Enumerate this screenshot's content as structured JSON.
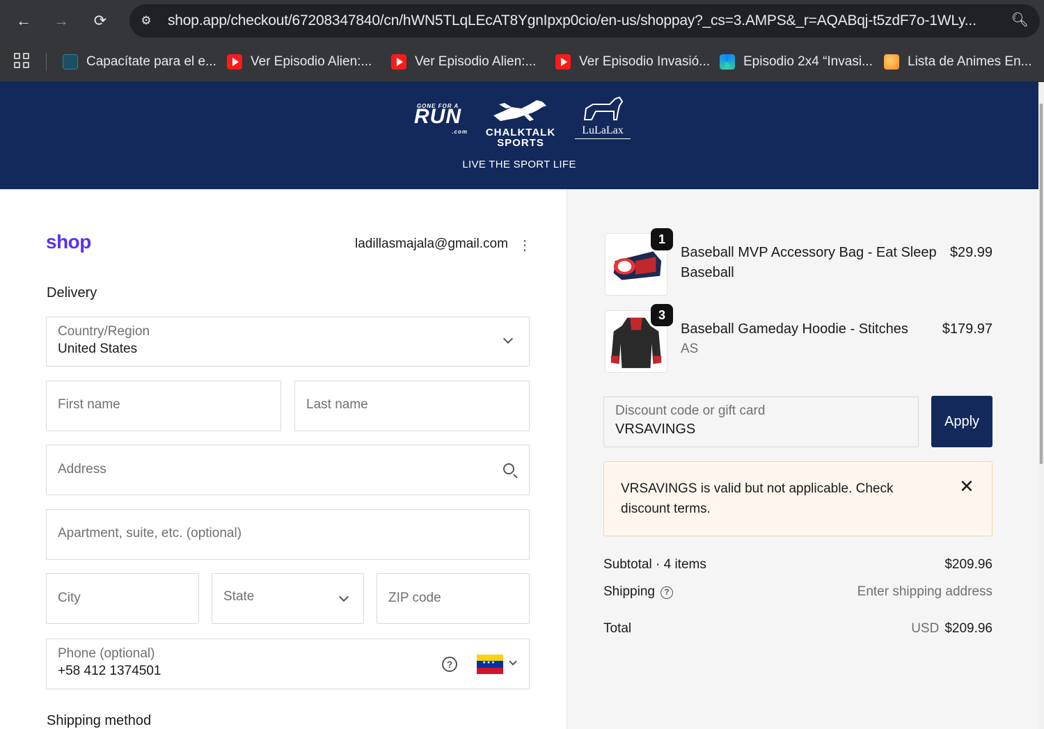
{
  "browser": {
    "url": "shop.app/checkout/67208347840/cn/hWN5TLqLEcAT8YgnIpxp0cio/en-us/shoppay?_cs=3.AMPS&_r=AQABqj-t5zdF7o-1WLy...",
    "bookmarks": [
      {
        "label": "Capacítate para el e...",
        "icon": "doc-icon"
      },
      {
        "label": "Ver Episodio Alien:...",
        "icon": "youtube-icon"
      },
      {
        "label": "Ver Episodio Alien:...",
        "icon": "youtube-icon"
      },
      {
        "label": "Ver Episodio Invasió...",
        "icon": "youtube-icon"
      },
      {
        "label": "Episodio 2x4 “Invasi...",
        "icon": "edge-icon"
      },
      {
        "label": "Lista de Animes En...",
        "icon": "anime-icon"
      }
    ]
  },
  "banner": {
    "logos": {
      "run_small": "GONE FOR A",
      "run_main": "RUN",
      "run_suffix": ".com",
      "chalk_line1": "CHALKTALK",
      "chalk_line2": "SPORTS",
      "lula": "LuLaLax"
    },
    "tagline": "LIVE THE SPORT LIFE"
  },
  "checkout": {
    "logo": "shop",
    "email": "ladillasmajala@gmail.com",
    "delivery_title": "Delivery",
    "country_label": "Country/Region",
    "country_value": "United States",
    "first_name_placeholder": "First name",
    "last_name_placeholder": "Last name",
    "address_placeholder": "Address",
    "apartment_placeholder": "Apartment, suite, etc. (optional)",
    "city_placeholder": "City",
    "state_placeholder": "State",
    "zip_placeholder": "ZIP code",
    "phone_label": "Phone (optional)",
    "phone_value": "+58 412 1374501",
    "shipping_method_title": "Shipping method"
  },
  "summary": {
    "items": [
      {
        "qty": "1",
        "name": "Baseball MVP Accessory Bag - Eat Sleep Baseball",
        "variant": "",
        "price": "$29.99"
      },
      {
        "qty": "3",
        "name": "Baseball Gameday Hoodie - Stitches",
        "variant": "AS",
        "price": "$179.97"
      }
    ],
    "discount_label": "Discount code or gift card",
    "discount_value": "VRSAVINGS",
    "apply_label": "Apply",
    "alert_message": "VRSAVINGS is valid but not applicable. Check discount terms.",
    "subtotal_label": "Subtotal · 4 items",
    "subtotal_value": "$209.96",
    "shipping_label": "Shipping",
    "shipping_value": "Enter shipping address",
    "total_label": "Total",
    "total_currency": "USD",
    "total_value": "$209.96"
  },
  "colors": {
    "banner": "#13295b",
    "shop_brand": "#5a31f4",
    "apply_button": "#13295b",
    "alert_bg": "#fff7ed"
  }
}
